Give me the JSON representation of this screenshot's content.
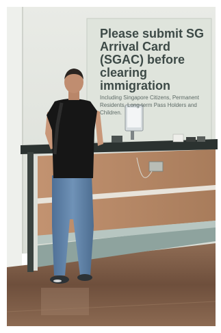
{
  "image": {
    "description_free": true
  },
  "sign": {
    "headline": "Please submit SG Arrival Card (SGAC) before clearing immigration",
    "subline": "Including Singapore Citizens, Permanent Residents, Long-term Pass Holders and Children."
  },
  "colors": {
    "wall": "#e6e8e2",
    "sign_panel": "#dfe4dc",
    "sign_text": "#3d4a47",
    "counter_top": "#2b3230",
    "counter_wood": "#b58863",
    "counter_base": "#9fb3ae",
    "floor": "#7a5a45",
    "shirt": "#161616",
    "jeans": "#5d7fa3"
  }
}
